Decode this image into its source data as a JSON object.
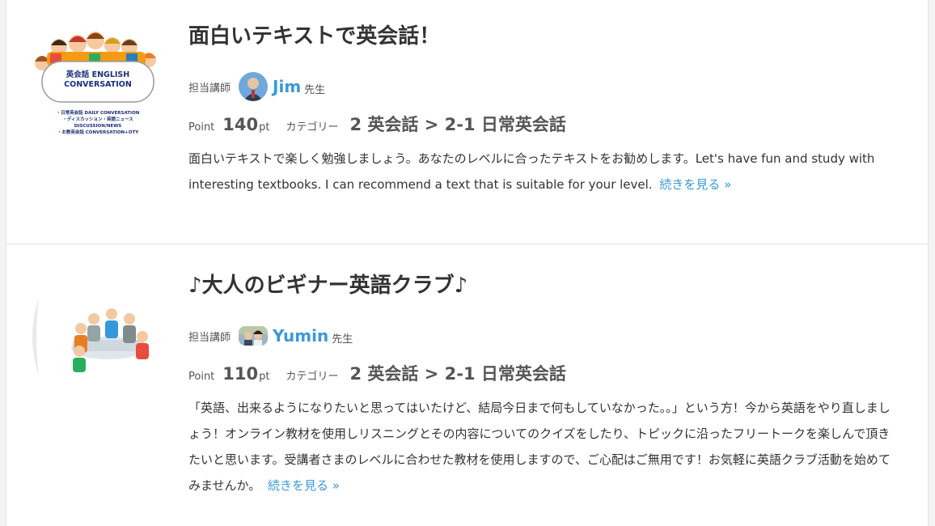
{
  "listings": [
    {
      "title": "面白いテキストで英会話！",
      "teacher_label": "担当講師",
      "teacher_name": "Jim",
      "teacher_suffix": "先生",
      "point_label": "Point",
      "points": "140",
      "point_unit": "pt",
      "category_label": "カテゴリー",
      "category": "2 英会話 > 2-1 日常英会話",
      "description": "面白いテキストで楽しく勉強しましょう。あなたのレベルに合ったテキストをお勧めします。Let's have fun and study with interesting textbooks. I can recommend a text that is suitable for your level.",
      "read_more": "続きを見る »",
      "thumbnail": {
        "badge_title": "英会話 ENGLISH CONVERSATION",
        "lines": [
          "・日常英会話 DAILY CONVERSATION",
          "・ディスカッション・英語ニュース",
          "DISCUSSION/NEWS",
          "・お教英会話 CONVERSATION+OTY"
        ]
      }
    },
    {
      "title": "♪大人のビギナー英語クラブ♪",
      "teacher_label": "担当講師",
      "teacher_name": "Yumin",
      "teacher_suffix": "先生",
      "point_label": "Point",
      "points": "110",
      "point_unit": "pt",
      "category_label": "カテゴリー",
      "category": "2 英会話 > 2-1 日常英会話",
      "description": "「英語、出来るようになりたいと思ってはいたけど、結局今日まで何もしていなかった。。」という方！今から英語をやり直しましょう！オンライン教材を使用しリスニングとその内容についてのクイズをしたり、トピックに沿ったフリートークを楽しんで頂きたいと思います。受講者さまのレベルに合わせた教材を使用しますので、ご心配はご無用です！お気軽に英語クラブ活動を始めてみませんか。",
      "read_more": "続きを見る »"
    }
  ],
  "colors": {
    "link": "#3a9ad9",
    "text": "#333333",
    "muted": "#555555"
  }
}
